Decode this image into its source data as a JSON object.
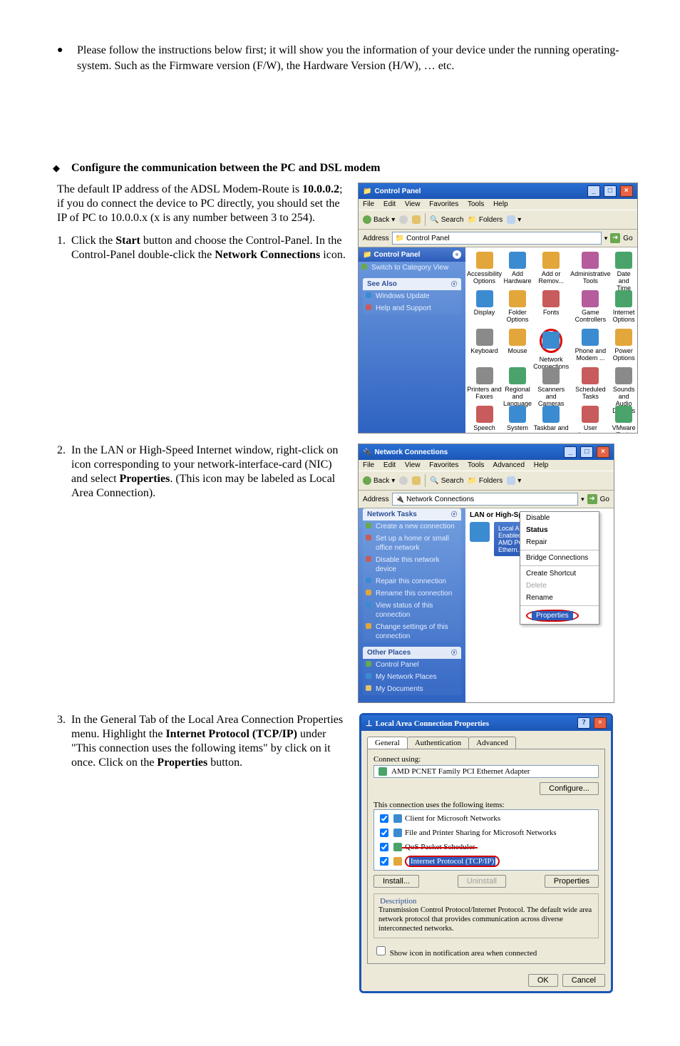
{
  "intro": {
    "bullet1": "Please follow the instructions below first; it will show you the information of your device under the running operating-system. Such as the Firmware version (F/W), the Hardware Version (H/W), … etc."
  },
  "step1": {
    "heading": "Configure the communication between the PC and DSL modem",
    "p1_a": "The default IP address of the ADSL Modem-Route is ",
    "p1_ip": "10.0.0.2",
    "p1_b": "; if you do connect the device to PC directly, you should set the IP of PC to 10.0.0.x (x is any number between 3 to 254)."
  },
  "step1_numbered": {
    "n1_a": "Click the ",
    "n1_b": "Start",
    "n1_c": " button and choose the Control-Panel. In the Control-Panel double-click the ",
    "n1_d": "Network Connections",
    "n1_e": " icon."
  },
  "cp": {
    "title": "Control Panel",
    "menu": [
      "File",
      "Edit",
      "View",
      "Favorites",
      "Tools",
      "Help"
    ],
    "tb": {
      "back": "Back",
      "search": "Search",
      "folders": "Folders"
    },
    "address_label": "Address",
    "address": "Control Panel",
    "go": "Go",
    "side_head": "Control Panel",
    "switch_view": "Switch to Category View",
    "see_also": "See Also",
    "see_items": [
      "Windows Update",
      "Help and Support"
    ],
    "items": [
      "Accessibility Options",
      "Add Hardware",
      "Add or Remov...",
      "Administrative Tools",
      "Date and Time",
      "Display",
      "Folder Options",
      "Fonts",
      "Game Controllers",
      "Internet Options",
      "Keyboard",
      "Mouse",
      "Network Connections",
      "Phone and Modem ...",
      "Power Options",
      "Printers and Faxes",
      "Regional and Language ...",
      "Scanners and Cameras",
      "Scheduled Tasks",
      "Sounds and Audio Devices",
      "Speech",
      "System",
      "Taskbar and",
      "User Accounts",
      "VMware Tools"
    ],
    "colors": [
      "#e2a63a",
      "#3b8bd1",
      "#e2a63a",
      "#b55c9c",
      "#4aa36a",
      "#3b8bd1",
      "#e2a63a",
      "#c85b5b",
      "#b55c9c",
      "#4aa36a",
      "#8a8a8a",
      "#e2a63a",
      "#3b8bd1",
      "#3b8bd1",
      "#e2a63a",
      "#8a8a8a",
      "#4aa36a",
      "#8a8a8a",
      "#c85b5b",
      "#8a8a8a",
      "#c85b5b",
      "#3b8bd1",
      "#3b8bd1",
      "#c85b5b",
      "#4aa36a"
    ]
  },
  "step2": {
    "a": "In the LAN or High-Speed Internet window, right-click on icon corresponding to your network-interface-card (NIC) and select ",
    "b": "Properties",
    "c": ". (This icon may be labeled as Local Area Connection)."
  },
  "nc": {
    "title": "Network Connections",
    "menu": [
      "File",
      "Edit",
      "View",
      "Favorites",
      "Tools",
      "Advanced",
      "Help"
    ],
    "tb": {
      "back": "Back",
      "search": "Search",
      "folders": "Folders"
    },
    "address_label": "Address",
    "address": "Network Connections",
    "go": "Go",
    "tasks_head": "Network Tasks",
    "tasks": [
      "Create a new connection",
      "Set up a home or small office network",
      "Disable this network device",
      "Repair this connection",
      "Rename this connection",
      "View status of this connection",
      "Change settings of this connection"
    ],
    "other_head": "Other Places",
    "other": [
      "Control Panel",
      "My Network Places",
      "My Documents"
    ],
    "category": "LAN or High-Speed Internet",
    "lan": {
      "l1": "Local Area Connection",
      "l2": "Enabled",
      "l3": "AMD PCNET Family PCI Ethern..."
    },
    "ctx": [
      "Disable",
      "Status",
      "Repair",
      "Bridge Connections",
      "Create Shortcut",
      "Delete",
      "Rename",
      "Properties"
    ]
  },
  "step3": {
    "a": "In the General Tab of the Local Area Connection Properties menu. Highlight the ",
    "b": "Internet Protocol (TCP/IP)",
    "c": " under \"This connection uses the following items\" by click on it once. Click on the ",
    "d": "Properties",
    "e": " button."
  },
  "props": {
    "title": "Local Area Connection Properties",
    "tabs": [
      "General",
      "Authentication",
      "Advanced"
    ],
    "connect_using": "Connect using:",
    "adapter": "AMD PCNET Family PCI Ethernet Adapter",
    "configure": "Configure...",
    "uses": "This connection uses the following items:",
    "items": [
      "Client for Microsoft Networks",
      "File and Printer Sharing for Microsoft Networks",
      "QoS Packet Scheduler",
      "Internet Protocol (TCP/IP)"
    ],
    "install": "Install...",
    "uninstall": "Uninstall",
    "properties": "Properties",
    "desc_title": "Description",
    "desc": "Transmission Control Protocol/Internet Protocol. The default wide area network protocol that provides communication across diverse interconnected networks.",
    "show_icon": "Show icon in notification area when connected",
    "ok": "OK",
    "cancel": "Cancel"
  }
}
